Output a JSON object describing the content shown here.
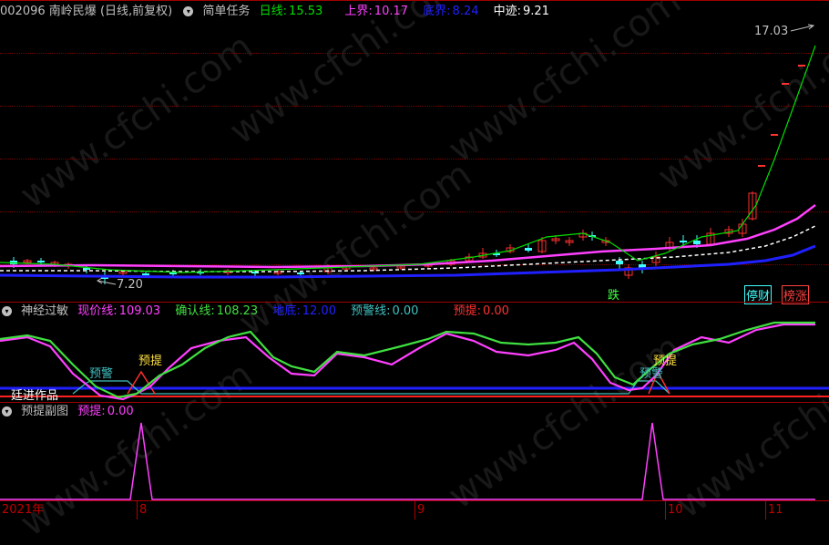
{
  "main_header": {
    "code": "002096",
    "name": "南岭民爆",
    "mode": "(日线,前复权)",
    "indicator": "简单任务",
    "daily_label": "日线:",
    "daily_value": "15.53",
    "upper_label": "上界:",
    "upper_value": "10.17",
    "bottom_label": "底界:",
    "bottom_value": "8.24",
    "mid_label": "中迹:",
    "mid_value": "9.21"
  },
  "price_labels": {
    "high": "17.03",
    "low": "7.20"
  },
  "signals": {
    "fall": "跌",
    "stop": "停财",
    "surge": "榜涨"
  },
  "sub_header": {
    "name": "神经过敏",
    "now_label": "现价线:",
    "now_value": "109.03",
    "confirm_label": "确认线:",
    "confirm_value": "108.23",
    "bottom_label": "地底:",
    "bottom_value": "12.00",
    "warn_label": "预警线:",
    "warn_value": "0.00",
    "pre_label": "预提:",
    "pre_value": "0.00"
  },
  "sub_annotations": {
    "warn": "预警",
    "pre": "预提",
    "credit": "廷进作品"
  },
  "third_header": {
    "name": "预提副图",
    "pre_label": "预提:",
    "pre_value": "0.00"
  },
  "time_axis": {
    "labels": [
      "2021年",
      "8",
      "9",
      "10",
      "11"
    ]
  },
  "watermark": "www.cfchi.com",
  "colors": {
    "bg": "#000000",
    "daily": "#00e000",
    "upper": "#ff40ff",
    "bottom": "#2020ff",
    "mid": "#ffffff",
    "up_candle": "#ff3030",
    "down_candle": "#40ffff",
    "now_line": "#ff40ff",
    "confirm_line": "#40e040",
    "floor_line": "#2020ff",
    "warn_line": "#40c0c0",
    "pre_line": "#ff3030"
  }
}
